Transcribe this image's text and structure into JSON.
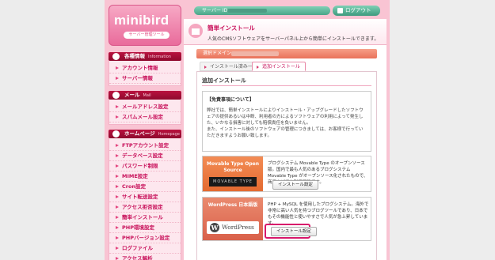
{
  "header": {
    "logo_text": "minibird",
    "logo_sub": "サーバー管理ツール",
    "server_id_label": "サーバー ID",
    "logout_label": "ログアウト"
  },
  "sidebar": {
    "sections": [
      {
        "title": "各種情報",
        "en": "Information",
        "items": [
          "アカウント情報",
          "サーバー情報"
        ]
      },
      {
        "title": "メール",
        "en": "Mail",
        "items": [
          "メールアドレス設定",
          "スパムメール設定"
        ]
      },
      {
        "title": "ホームページ",
        "en": "Homepage",
        "items": [
          "FTPアカウント設定",
          "データベース設定",
          "パスワード制限",
          "MIME設定",
          "Cron設定",
          "サイト転送設定",
          "アクセス拒否設定",
          "簡単インストール",
          "PHP環境設定",
          "PHPバージョン設定",
          "ログファイル",
          "アクセス解析"
        ]
      }
    ]
  },
  "main": {
    "title": "簡単インストール",
    "description": "人気のCMSソフトウェアをサーバーパネル上から簡単にインストールできます。",
    "domain_label": "選択ドメイン",
    "tabs": [
      "インストール済み一覧",
      "追加インストール"
    ],
    "panel_title": "追加インストール",
    "notice_title": "【免責事項について】",
    "notice_p1": "弊社では、簡単インストールによりインストール・アップグレードしたソフトウェアの提供あるいは中断、利用者の方によるソフトウェアの利用によって発生した、いかなる損害に対しても賠償責任を負いません。",
    "notice_p2": "また、インストール後のソフトウェアの管理につきましては、お客様で行っていただきますようお願い致します。",
    "apps": [
      {
        "name": "Movable Type Open Source",
        "logo": "MOVABLE TYPE",
        "desc": "ブログシステム Movable Type のオープンソース版。国内で最も人気のあるブログシステム Movable Type がオープンソース化されたもので、商用などでも利用可能です。",
        "button": "インストール設定"
      },
      {
        "name": "WordPress 日本語版",
        "logo": "WordPress",
        "desc": "PHP + MySQL を使用したブログシステム。海外で非常に高い人気を持つブログツールであり、日本でもその機能性と使いやすさで人気が急上昇しています。",
        "button": "インストール設定"
      }
    ]
  },
  "colors": {
    "accent": "#c8105a",
    "section_bg": "#b9123f",
    "topbar": "#5bb89a",
    "highlight": "#d8176b"
  }
}
